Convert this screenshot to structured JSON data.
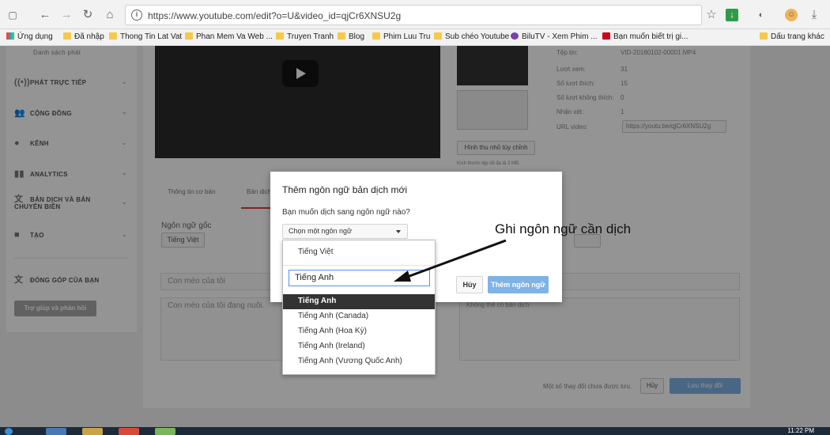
{
  "browser": {
    "url": "https://www.youtube.com/edit?o=U&video_id=qjCr6XNSU2g",
    "bookmarks": [
      "Ứng dụng",
      "Đã nhập",
      "Thong Tin Lat Vat",
      "Phan Mem Va Web ...",
      "Truyen Tranh",
      "Blog",
      "Phim Luu Tru",
      "Sub chéo Youtube",
      "BiluTV - Xem Phim ...",
      "Bạn muốn biết trị gi...",
      "Dấu trang khác"
    ]
  },
  "sidebar": {
    "top_label": "Danh sách phát",
    "items": [
      {
        "label": "PHÁT TRỰC TIẾP",
        "icon": "live-icon"
      },
      {
        "label": "CỘNG ĐỒNG",
        "icon": "community-icon"
      },
      {
        "label": "KÊNH",
        "icon": "channel-icon"
      },
      {
        "label": "ANALYTICS",
        "icon": "analytics-icon"
      },
      {
        "label": "BẢN DỊCH VÀ BẢN CHUYỂN BIÊN",
        "icon": "translate-icon"
      },
      {
        "label": "TẠO",
        "icon": "create-icon"
      },
      {
        "label": "ĐÓNG GÓP CỦA BẠN",
        "icon": "contribute-icon"
      }
    ],
    "help_button": "Trợ giúp và phản hồi"
  },
  "video_info": {
    "rows": [
      {
        "label": "Tệp tin:",
        "value": "VID-20180102-00001.MP4"
      },
      {
        "label": "Lượt xem:",
        "value": "31"
      },
      {
        "label": "Số lượt thích:",
        "value": "15"
      },
      {
        "label": "Số lượt không thích:",
        "value": "0"
      },
      {
        "label": "Nhận xét:",
        "value": "1"
      },
      {
        "label": "URL video:",
        "value": "https://youtu.be/qjCr6XNSU2g"
      }
    ],
    "custom_thumb_button": "Hình thu nhỏ tùy chỉnh",
    "thumb_note": "Kích thước tệp tối đa là 2 MB."
  },
  "editor": {
    "tabs": [
      "Thông tin cơ bản",
      "Bản dịch"
    ],
    "orig_lang_label": "Ngôn ngữ gốc",
    "orig_lang_value": "Tiếng Việt",
    "title_value": "Con mèo của tôi",
    "desc_value": "Con mèo của tôi đang nuôi.",
    "right_placeholder": "Không thể có bản dịch",
    "unsaved_note": "Một số thay đổi chưa được lưu.",
    "cancel_label": "Hủy",
    "save_label": "Lưu thay đổi"
  },
  "dialog": {
    "title": "Thêm ngôn ngữ bản dịch mới",
    "question": "Bạn muốn dịch sang ngôn ngữ nào?",
    "select_placeholder": "Chọn một ngôn ngữ",
    "cancel_label": "Hủy",
    "add_label": "Thêm ngôn ngữ"
  },
  "dropdown": {
    "first_option": "Tiếng Việt",
    "search_value": "Tiếng Anh",
    "options": [
      "Tiếng Anh",
      "Tiếng Anh (Canada)",
      "Tiếng Anh (Hoa Kỳ)",
      "Tiếng Anh (Ireland)",
      "Tiếng Anh (Vương Quốc Anh)"
    ],
    "selected_index": 0
  },
  "annotation": "Ghi ngôn ngữ cần dịch",
  "taskbar": {
    "clock": "11:22 PM"
  },
  "colors": {
    "primary_button": "#7fb2e5",
    "focus_border": "#4d90fe",
    "highlight_row": "#333333"
  }
}
